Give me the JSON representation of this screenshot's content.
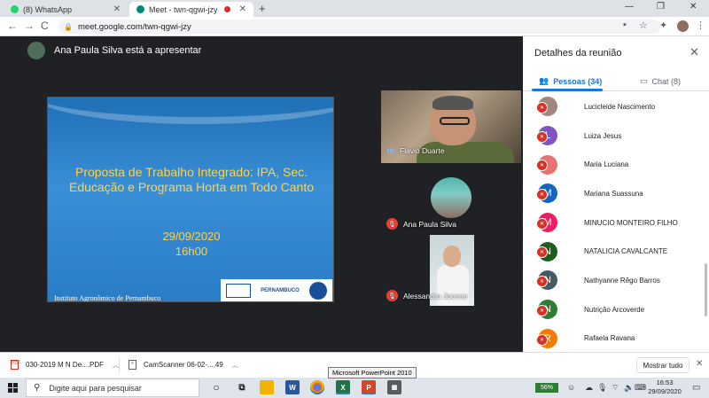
{
  "browser": {
    "tabs": [
      {
        "label": "(8) WhatsApp",
        "active": false,
        "favicon_color": "#25d366"
      },
      {
        "label": "Meet - twn-qgwi-jzy",
        "active": true,
        "favicon_color": "#00897b"
      }
    ],
    "new_tab_symbol": "+",
    "url": "meet.google.com/twn-qgwi-jzy",
    "back": "←",
    "forward": "→",
    "reload": "C",
    "window_controls": {
      "minimize": "—",
      "maximize": "❐",
      "close": "✕"
    }
  },
  "meet": {
    "presenter_text": "Ana Paula Silva está a apresentar",
    "slide": {
      "title": "Proposta de Trabalho Integrado: IPA, Sec. Educação e Programa Horta em Todo Canto",
      "date": "29/09/2020",
      "time": "16h00",
      "footer": "Instituto Agronômico de Pernambuco",
      "logo_text": "PERNAMBUCO",
      "logo_ipa": "IPA"
    },
    "tiles": [
      {
        "name": "Flavio Duarte",
        "speaking": true
      },
      {
        "name": "Ana Paula Silva",
        "muted": true
      },
      {
        "name": "Alessandra Jocene",
        "muted": true
      }
    ]
  },
  "panel": {
    "title": "Detalhes da reunião",
    "tab_people": "Pessoas (34)",
    "tab_chat": "Chat (8)",
    "participants": [
      {
        "name": "Lucicleide Nascimento",
        "initial": "",
        "color": "#a1887f"
      },
      {
        "name": "Luiza Jesus",
        "initial": "L",
        "color": "#7e57c2"
      },
      {
        "name": "Maria Luciana",
        "initial": "",
        "color": "#e57373"
      },
      {
        "name": "Mariana Suassuna",
        "initial": "M",
        "color": "#1565c0"
      },
      {
        "name": "MINUCIO MONTEIRO FILHO",
        "initial": "M",
        "color": "#e91e63"
      },
      {
        "name": "NATALICIA CAVALCANTE",
        "initial": "N",
        "color": "#1b5e20"
      },
      {
        "name": "Nathyanne Rêgo Barros",
        "initial": "N",
        "color": "#455a64"
      },
      {
        "name": "Nutrição Arcoverde",
        "initial": "N",
        "color": "#2e7d32"
      },
      {
        "name": "Rafaela Ravana",
        "initial": "R",
        "color": "#f57c00"
      }
    ]
  },
  "downloads": {
    "items": [
      "030-2019 M N De....PDF",
      "CamScanner 06-02-....49"
    ],
    "show_all": "Mostrar tudo"
  },
  "tooltip": "Microsoft PowerPoint 2010",
  "taskbar": {
    "search_placeholder": "Digite aqui para pesquisar",
    "battery": "56%",
    "time": "16:53",
    "date": "29/09/2020"
  }
}
